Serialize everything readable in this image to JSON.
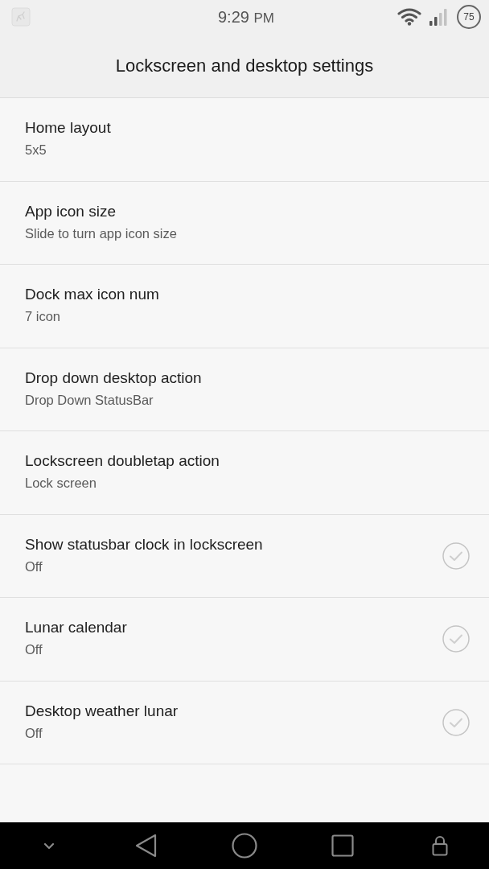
{
  "status_bar": {
    "time": "9:29",
    "period": "PM",
    "battery": "75"
  },
  "header": {
    "title": "Lockscreen and desktop settings"
  },
  "settings": [
    {
      "kind": "value",
      "title": "Home layout",
      "summary": "5x5"
    },
    {
      "kind": "value",
      "title": "App icon size",
      "summary": "Slide to turn app icon size"
    },
    {
      "kind": "value",
      "title": "Dock max icon num",
      "summary": "7 icon"
    },
    {
      "kind": "value",
      "title": "Drop down desktop action",
      "summary": "Drop Down StatusBar"
    },
    {
      "kind": "value",
      "title": "Lockscreen doubletap action",
      "summary": "Lock screen"
    },
    {
      "kind": "toggle",
      "title": "Show statusbar clock in lockscreen",
      "summary": "Off",
      "checked": false
    },
    {
      "kind": "toggle",
      "title": "Lunar calendar",
      "summary": "Off",
      "checked": false
    },
    {
      "kind": "toggle",
      "title": "Desktop weather lunar",
      "summary": "Off",
      "checked": false
    }
  ]
}
